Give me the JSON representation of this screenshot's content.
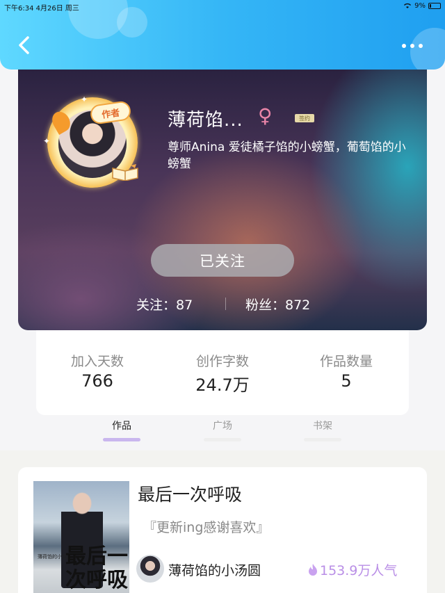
{
  "status_bar": {
    "time_date": "下午6:34   4月26日 周三",
    "battery": "9%"
  },
  "header": {
    "back_icon": "chevron-left-icon",
    "more_icon": "more-dots-icon"
  },
  "profile": {
    "author_badge": "作者",
    "name": "薄荷馅...",
    "gender_symbol": "♀",
    "sign_tag": "签约",
    "bio": "尊师Anina 爱徒橘子馅的小螃蟹，葡萄馅的小螃蟹",
    "follow_button": "已关注",
    "following": "关注：87",
    "fans": "粉丝：872"
  },
  "stats": [
    {
      "label": "加入天数",
      "value": "766"
    },
    {
      "label": "创作字数",
      "value": "24.7万"
    },
    {
      "label": "作品数量",
      "value": "5"
    }
  ],
  "tabs": [
    {
      "label": "作品",
      "active": true
    },
    {
      "label": "广场",
      "active": false
    },
    {
      "label": "书架",
      "active": false
    }
  ],
  "work": {
    "cover_title": "最后一次呼吸",
    "cover_subtitle": "薄荷馅的小汤圆 ◎著",
    "title": "最后一次呼吸",
    "description": "『更新ing感谢喜欢』",
    "author": "薄荷馅的小汤圆",
    "popularity": "153.9万人气"
  },
  "colors": {
    "header_blue": "#35b6f6",
    "tab_active_underline": "#c9b6ee",
    "popularity_purple": "#b98ee6",
    "gender_pink": "#e985a8"
  }
}
